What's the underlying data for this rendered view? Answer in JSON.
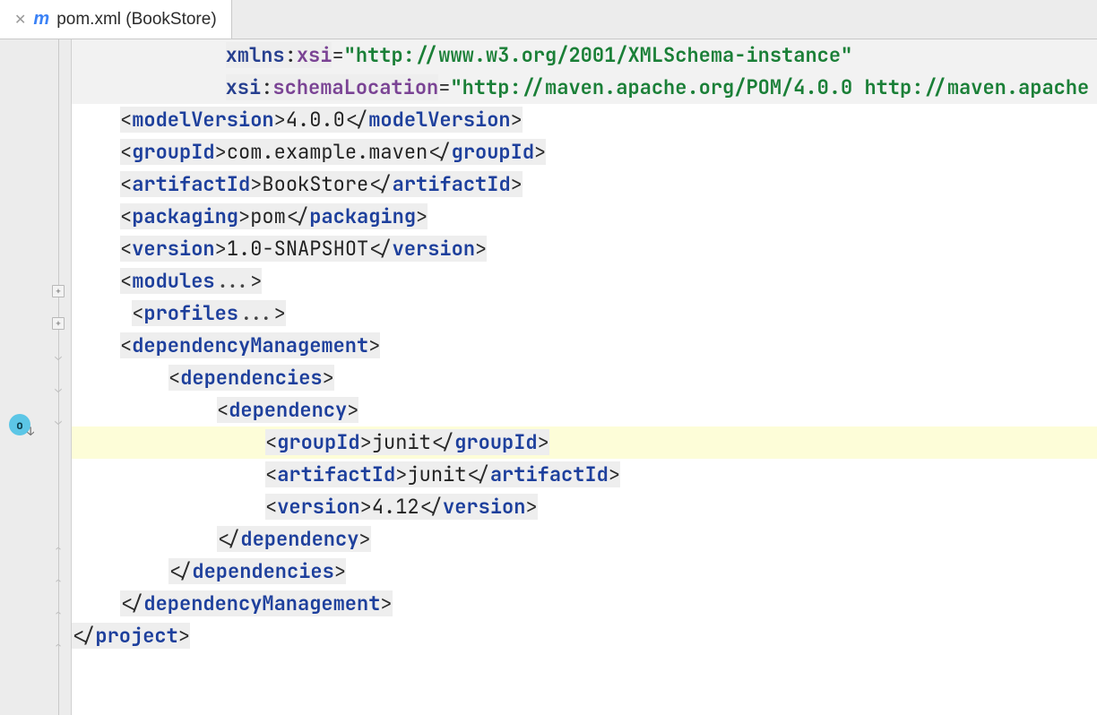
{
  "tab": {
    "title": "pom.xml (BookStore)",
    "icon_label": "m"
  },
  "xml": {
    "ns_prefix": "xmlns",
    "ns_local": "xsi",
    "ns_value": "\"http://www.w3.org/2001/XMLSchema-instance\"",
    "sl_prefix": "xsi",
    "sl_local": "schemaLocation",
    "sl_value": "\"http://maven.apache.org/POM/4.0.0 http://maven.apache",
    "modelVersion_tag": "modelVersion",
    "modelVersion_val": "4.0.0",
    "groupId_tag": "groupId",
    "groupId_val": "com.example.maven",
    "artifactId_tag": "artifactId",
    "artifactId_val": "BookStore",
    "packaging_tag": "packaging",
    "packaging_val": "pom",
    "version_tag": "version",
    "version_val": "1.0-SNAPSHOT",
    "modules_tag": "modules",
    "profiles_tag": "profiles",
    "depMgmt_tag": "dependencyManagement",
    "deps_tag": "dependencies",
    "dep_tag": "dependency",
    "dep_groupId_val": "junit",
    "dep_artifactId_val": "junit",
    "dep_version_val": "4.12",
    "project_tag": "project",
    "ellipsis": "..."
  }
}
